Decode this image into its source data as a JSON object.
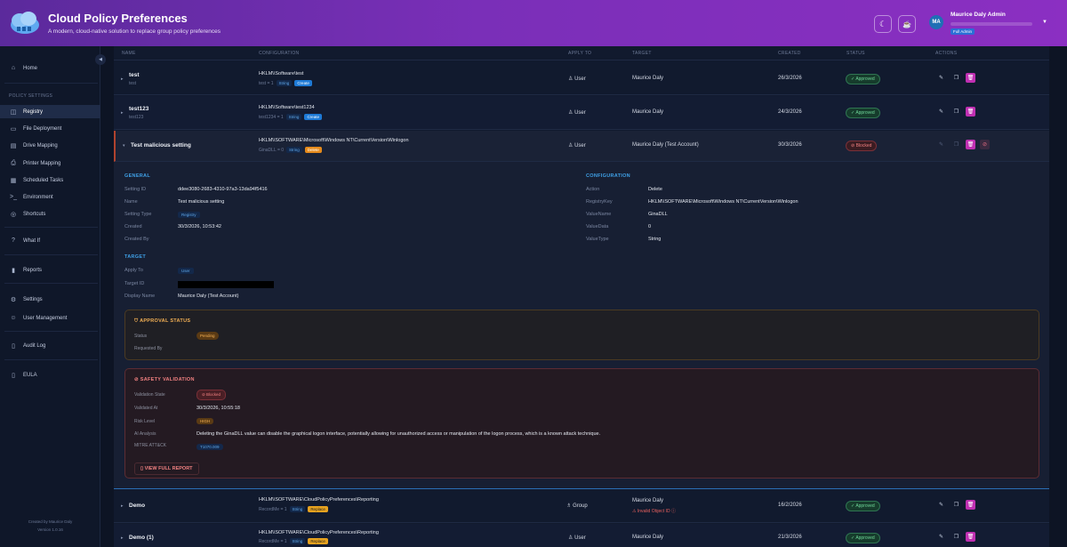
{
  "header": {
    "title": "Cloud Policy Preferences",
    "subtitle": "A modern, cloud-native solution to replace group policy preferences",
    "theme_icon": "moon-icon",
    "coffee_icon": "coffee-icon",
    "user": {
      "initials": "MA",
      "name": "Maurice Daly Admin",
      "role": "Full Admin"
    }
  },
  "sidebar": {
    "home": "Home",
    "section_label": "POLICY SETTINGS",
    "items": [
      {
        "label": "Registry",
        "icon": "database-icon"
      },
      {
        "label": "File Deployment",
        "icon": "file-icon"
      },
      {
        "label": "Drive Mapping",
        "icon": "drive-icon"
      },
      {
        "label": "Printer Mapping",
        "icon": "printer-icon"
      },
      {
        "label": "Scheduled Tasks",
        "icon": "calendar-icon"
      },
      {
        "label": "Environment",
        "icon": "terminal-icon"
      },
      {
        "label": "Shortcuts",
        "icon": "globe-icon"
      }
    ],
    "what_if": "What If",
    "reports": "Reports",
    "settings": "Settings",
    "user_management": "User Management",
    "audit_log": "Audit Log",
    "eula": "EULA",
    "footer_line1": "Created by Maurice Daly",
    "footer_line2": "Version 1.0.16"
  },
  "table": {
    "columns": [
      "NAME",
      "CONFIGURATION",
      "APPLY TO",
      "TARGET",
      "CREATED",
      "STATUS",
      "ACTIONS"
    ],
    "rows": [
      {
        "name": "test",
        "sub": "test",
        "key": "HKLM\\\\Software\\test",
        "value": "test = 1",
        "type": "String",
        "op": "Create",
        "apply": "User",
        "target": "Maurice Daly",
        "created": "26/3/2026",
        "status": "Approved"
      },
      {
        "name": "test123",
        "sub": "test123",
        "key": "HKLM\\\\Software\\test1234",
        "value": "test1234 = 1",
        "type": "String",
        "op": "Create",
        "apply": "User",
        "target": "Maurice Daly",
        "created": "24/3/2026",
        "status": "Approved"
      },
      {
        "name": "Test malicious setting",
        "sub": "",
        "key": "HKLM\\\\SOFTWARE\\Microsoft\\Windows NT\\CurrentVersion\\Winlogon",
        "value": "GinaDLL = 0",
        "type": "String",
        "op": "Delete",
        "apply": "User",
        "target": "Maurice Daly (Test Account)",
        "created": "30/3/2026",
        "status": "Blocked"
      },
      {
        "name": "Demo",
        "sub": "",
        "key": "HKLM\\\\SOFTWARE\\CloudPolicyPreferences\\Reporting",
        "value": "RecordMe = 1",
        "type": "String",
        "op": "Replace",
        "apply": "Group",
        "target": "Maurice Daly",
        "warning": "Invalid Object ID",
        "created": "16/2/2026",
        "status": "Approved"
      },
      {
        "name": "Demo (1)",
        "sub": "",
        "key": "HKLM\\\\SOFTWARE\\CloudPolicyPreferences\\Reporting",
        "value": "RecordMe = 1",
        "type": "String",
        "op": "Replace",
        "apply": "User",
        "target": "Maurice Daly",
        "created": "21/3/2026",
        "status": "Approved"
      }
    ]
  },
  "detail": {
    "general_title": "GENERAL",
    "setting_id_label": "Setting ID",
    "setting_id": "ddee3080-2683-4310-97a3-13da94f5416",
    "name_label": "Name",
    "name": "Test malicious setting",
    "type_label": "Setting Type",
    "type": "Registry",
    "created_label": "Created",
    "created": "30/3/2026, 10:53:42",
    "created_by_label": "Created By",
    "target_title": "TARGET",
    "apply_to_label": "Apply To",
    "apply_to": "User",
    "target_id_label": "Target ID",
    "display_name_label": "Display Name",
    "display_name": "Maurice Daly (Test Account)",
    "config_title": "CONFIGURATION",
    "action_label": "Action",
    "action": "Delete",
    "regkey_label": "RegistryKey",
    "regkey": "HKLM\\\\SOFTWARE\\Microsoft\\Windows NT\\CurrentVersion\\Winlogon",
    "valuename_label": "ValueName",
    "valuename": "GinaDLL",
    "valuedata_label": "ValueData",
    "valuedata": "0",
    "valuetype_label": "ValueType",
    "valuetype": "String",
    "approval": {
      "title": "APPROVAL STATUS",
      "status_label": "Status",
      "status": "Pending",
      "requested_label": "Requested By"
    },
    "safety": {
      "title": "SAFETY VALIDATION",
      "state_label": "Validation State",
      "state": "Blocked",
      "validated_label": "Validated At",
      "validated": "30/3/2026, 10:55:18",
      "risk_label": "Risk Level",
      "risk": "HIGH",
      "ai_label": "AI Analysis",
      "ai": "Deleting the GinaDLL value can disable the graphical logon interface, potentially allowing for unauthorized access or manipulation of the logon process, which is a known attack technique.",
      "mitre_label": "MITRE ATT&CK",
      "mitre": "T1070.009",
      "report_button": "VIEW FULL REPORT"
    }
  },
  "colors": {
    "accent": "#3fa1e8",
    "header_start": "#5b2a9c",
    "header_end": "#8b2fc2",
    "approved": "#6fd79a",
    "blocked": "#f08080",
    "delete_action": "#c02fb2"
  }
}
